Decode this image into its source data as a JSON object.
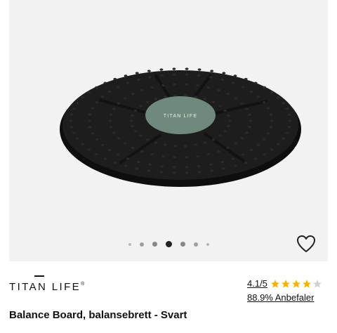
{
  "product": {
    "brand_name": "TITAN LIFE",
    "brand_mark": "®",
    "image_logo_text": "TITAN LIFE",
    "title": "Balance Board, balansebrett - Svart",
    "rating_text": "4.1/5",
    "rating": 4.1,
    "rating_max": 5,
    "recommend_text": "88.9% Anbefaler"
  },
  "gallery": {
    "dot_count": 7,
    "active_index": 3
  },
  "colors": {
    "accent_star": "#f5b301",
    "star_empty": "#d0d0d0",
    "board": "#1c1c1c",
    "board_center": "#6f8a7c"
  },
  "icons": {
    "favorite": "heart-outline-icon",
    "star": "star-icon"
  }
}
